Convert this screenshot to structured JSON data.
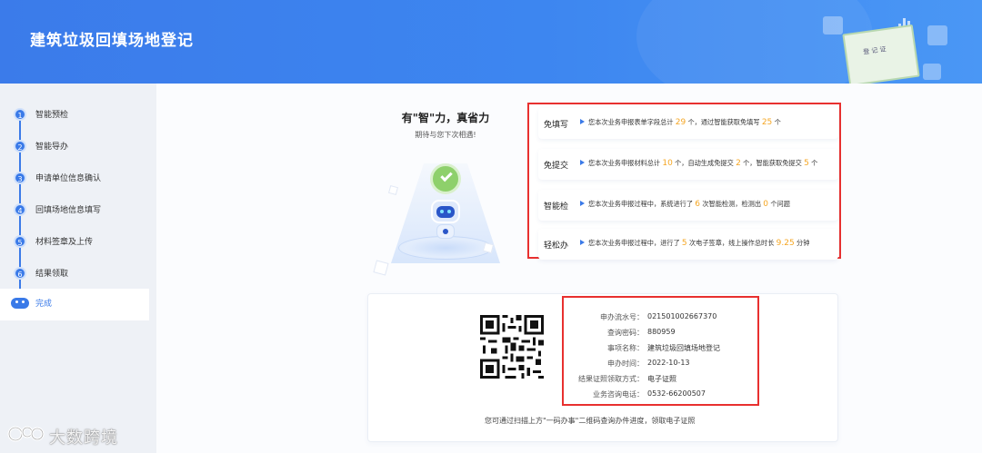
{
  "header": {
    "title": "建筑垃圾回填场地登记",
    "cert_label": "登 记 证"
  },
  "sidebar": {
    "steps": [
      {
        "num": "1",
        "label": "智能预检"
      },
      {
        "num": "2",
        "label": "智能导办"
      },
      {
        "num": "3",
        "label": "申请单位信息确认"
      },
      {
        "num": "4",
        "label": "回填场地信息填写"
      },
      {
        "num": "5",
        "label": "材料签章及上传"
      },
      {
        "num": "6",
        "label": "结果领取"
      },
      {
        "num": "",
        "label": "完成",
        "icon": "robot-icon",
        "active": true
      }
    ]
  },
  "slogan": {
    "line1": "有\"智\"力，真省力",
    "line2": "期待与您下次相遇!"
  },
  "stats": [
    {
      "name": "免填写",
      "pre": "您本次业务申报表单字段总计 ",
      "n1": "29",
      "mid": " 个，通过智能获取免填写 ",
      "n2": "25",
      "post": " 个"
    },
    {
      "name": "免提交",
      "pre": "您本次业务申报材料总计 ",
      "n1": "10",
      "mid": " 个，自动生成免提交 ",
      "n2": "2",
      "mid2": " 个，智能获取免提交 ",
      "n3": "5",
      "post": " 个"
    },
    {
      "name": "智能检",
      "pre": "您本次业务申报过程中，系统进行了 ",
      "n1": "6",
      "mid": " 次智能检测，检测出 ",
      "n2": "0",
      "post": " 个问题"
    },
    {
      "name": "轻松办",
      "pre": "您本次业务申报过程中，进行了 ",
      "n1": "5",
      "mid": " 次电子签章，线上操作总时长 ",
      "n2": "9.25",
      "post": " 分钟"
    }
  ],
  "info": {
    "rows": [
      {
        "k": "申办流水号：",
        "v": "021501002667370"
      },
      {
        "k": "查询密码：",
        "v": "880959"
      },
      {
        "k": "事项名称：",
        "v": "建筑垃圾回填场地登记"
      },
      {
        "k": "申办时间：",
        "v": "2022-10-13"
      },
      {
        "k": "结果证照领取方式：",
        "v": "电子证照"
      },
      {
        "k": "业务咨询电话：",
        "v": "0532-66200507"
      }
    ],
    "footnote": "您可通过扫描上方\"一码办事\"二维码查询办件进度，领取电子证照"
  },
  "watermark": {
    "text": "大数跨境"
  },
  "colors": {
    "primary": "#3a7ae8",
    "highlight": "#f5a623",
    "annotation_border": "#e8302f"
  }
}
